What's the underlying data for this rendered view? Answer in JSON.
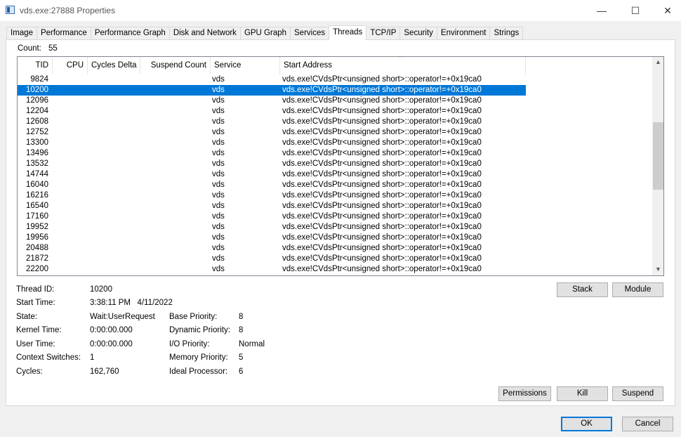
{
  "window": {
    "title": "vds.exe:27888 Properties",
    "minimize": "—",
    "maximize": "☐",
    "close": "✕"
  },
  "tabs": [
    "Image",
    "Performance",
    "Performance Graph",
    "Disk and Network",
    "GPU Graph",
    "Services",
    "Threads",
    "TCP/IP",
    "Security",
    "Environment",
    "Strings"
  ],
  "active_tab": "Threads",
  "count": {
    "label": "Count:",
    "value": "55"
  },
  "columns": [
    "TID",
    "CPU",
    "Cycles Delta",
    "Suspend Count",
    "Service",
    "Start Address"
  ],
  "sorted_column": "Start Address",
  "rows": [
    {
      "tid": "9824",
      "service": "vds",
      "address": "vds.exe!CVdsPtr<unsigned short>::operator!=+0x19ca0"
    },
    {
      "tid": "10200",
      "service": "vds",
      "address": "vds.exe!CVdsPtr<unsigned short>::operator!=+0x19ca0",
      "selected": true
    },
    {
      "tid": "12096",
      "service": "vds",
      "address": "vds.exe!CVdsPtr<unsigned short>::operator!=+0x19ca0"
    },
    {
      "tid": "12204",
      "service": "vds",
      "address": "vds.exe!CVdsPtr<unsigned short>::operator!=+0x19ca0"
    },
    {
      "tid": "12608",
      "service": "vds",
      "address": "vds.exe!CVdsPtr<unsigned short>::operator!=+0x19ca0"
    },
    {
      "tid": "12752",
      "service": "vds",
      "address": "vds.exe!CVdsPtr<unsigned short>::operator!=+0x19ca0"
    },
    {
      "tid": "13300",
      "service": "vds",
      "address": "vds.exe!CVdsPtr<unsigned short>::operator!=+0x19ca0"
    },
    {
      "tid": "13496",
      "service": "vds",
      "address": "vds.exe!CVdsPtr<unsigned short>::operator!=+0x19ca0"
    },
    {
      "tid": "13532",
      "service": "vds",
      "address": "vds.exe!CVdsPtr<unsigned short>::operator!=+0x19ca0"
    },
    {
      "tid": "14744",
      "service": "vds",
      "address": "vds.exe!CVdsPtr<unsigned short>::operator!=+0x19ca0"
    },
    {
      "tid": "16040",
      "service": "vds",
      "address": "vds.exe!CVdsPtr<unsigned short>::operator!=+0x19ca0"
    },
    {
      "tid": "16216",
      "service": "vds",
      "address": "vds.exe!CVdsPtr<unsigned short>::operator!=+0x19ca0"
    },
    {
      "tid": "16540",
      "service": "vds",
      "address": "vds.exe!CVdsPtr<unsigned short>::operator!=+0x19ca0"
    },
    {
      "tid": "17160",
      "service": "vds",
      "address": "vds.exe!CVdsPtr<unsigned short>::operator!=+0x19ca0"
    },
    {
      "tid": "19952",
      "service": "vds",
      "address": "vds.exe!CVdsPtr<unsigned short>::operator!=+0x19ca0"
    },
    {
      "tid": "19956",
      "service": "vds",
      "address": "vds.exe!CVdsPtr<unsigned short>::operator!=+0x19ca0"
    },
    {
      "tid": "20488",
      "service": "vds",
      "address": "vds.exe!CVdsPtr<unsigned short>::operator!=+0x19ca0"
    },
    {
      "tid": "21872",
      "service": "vds",
      "address": "vds.exe!CVdsPtr<unsigned short>::operator!=+0x19ca0"
    },
    {
      "tid": "22200",
      "service": "vds",
      "address": "vds.exe!CVdsPtr<unsigned short>::operator!=+0x19ca0"
    }
  ],
  "details": {
    "thread_id": {
      "label": "Thread ID:",
      "value": "10200"
    },
    "start_time": {
      "label": "Start Time:",
      "value": "3:38:11 PM   4/11/2022"
    },
    "state": {
      "label": "State:",
      "value": "Wait:UserRequest"
    },
    "kernel_time": {
      "label": "Kernel Time:",
      "value": "0:00:00.000"
    },
    "user_time": {
      "label": "User Time:",
      "value": "0:00:00.000"
    },
    "context_switches": {
      "label": "Context Switches:",
      "value": "1"
    },
    "cycles": {
      "label": "Cycles:",
      "value": "162,760"
    },
    "base_priority": {
      "label": "Base Priority:",
      "value": "8"
    },
    "dynamic_priority": {
      "label": "Dynamic Priority:",
      "value": "8"
    },
    "io_priority": {
      "label": "I/O Priority:",
      "value": "Normal"
    },
    "memory_priority": {
      "label": "Memory Priority:",
      "value": "5"
    },
    "ideal_processor": {
      "label": "Ideal Processor:",
      "value": "6"
    }
  },
  "buttons": {
    "stack": "Stack",
    "module": "Module",
    "permissions": "Permissions",
    "kill": "Kill",
    "suspend": "Suspend",
    "ok": "OK",
    "cancel": "Cancel"
  },
  "colors": {
    "selection": "#0078d7"
  }
}
